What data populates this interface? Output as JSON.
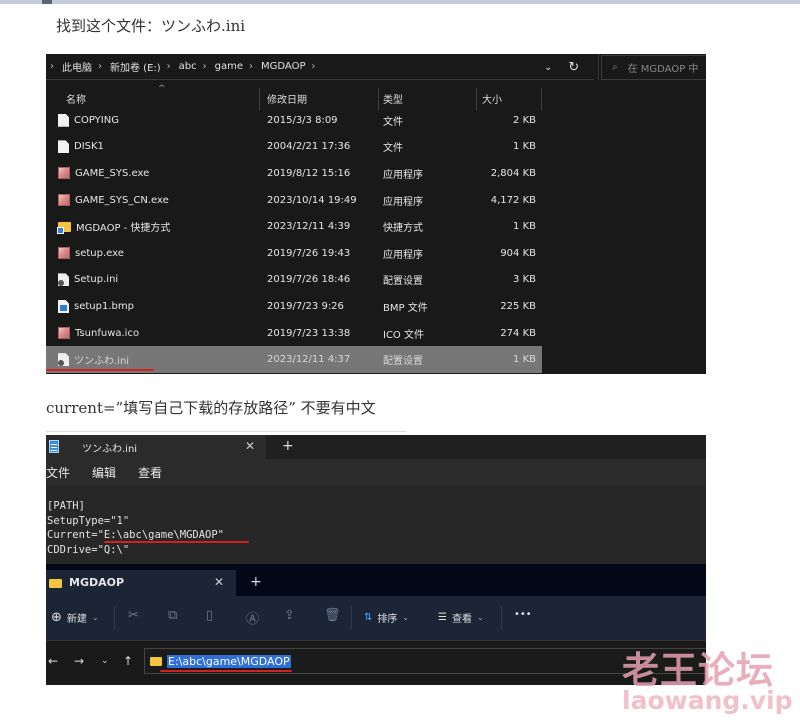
{
  "captions": {
    "step1": "找到这个文件：ツンふわ.ini",
    "step2": "current=”填写自己下载的存放路径”  不要有中文"
  },
  "explorer1": {
    "breadcrumb": [
      "此电脑",
      "新加卷 (E:)",
      "abc",
      "game",
      "MGDAOP"
    ],
    "search_placeholder": "在 MGDAOP 中",
    "columns": {
      "name": "名称",
      "date": "修改日期",
      "type": "类型",
      "size": "大小"
    },
    "files": [
      {
        "name": "COPYING",
        "date": "2015/3/3 8:09",
        "type": "文件",
        "size": "2 KB",
        "icon": "document-icon"
      },
      {
        "name": "DISK1",
        "date": "2004/2/21 17:36",
        "type": "文件",
        "size": "1 KB",
        "icon": "document-icon"
      },
      {
        "name": "GAME_SYS.exe",
        "date": "2019/8/12 15:16",
        "type": "应用程序",
        "size": "2,804 KB",
        "icon": "app-icon"
      },
      {
        "name": "GAME_SYS_CN.exe",
        "date": "2023/10/14 19:49",
        "type": "应用程序",
        "size": "4,172 KB",
        "icon": "app-icon"
      },
      {
        "name": "MGDAOP - 快捷方式",
        "date": "2023/12/11 4:39",
        "type": "快捷方式",
        "size": "1 KB",
        "icon": "shortcut-folder-icon"
      },
      {
        "name": "setup.exe",
        "date": "2019/7/26 19:43",
        "type": "应用程序",
        "size": "904 KB",
        "icon": "app-icon"
      },
      {
        "name": "Setup.ini",
        "date": "2019/7/26 18:46",
        "type": "配置设置",
        "size": "3 KB",
        "icon": "settings-file-icon"
      },
      {
        "name": "setup1.bmp",
        "date": "2019/7/23 9:26",
        "type": "BMP 文件",
        "size": "225 KB",
        "icon": "image-file-icon"
      },
      {
        "name": "Tsunfuwa.ico",
        "date": "2019/7/23 13:38",
        "type": "ICO 文件",
        "size": "274 KB",
        "icon": "app-icon"
      },
      {
        "name": "ツンふわ.ini",
        "date": "2023/12/11 4:37",
        "type": "配置设置",
        "size": "1 KB",
        "icon": "settings-file-icon",
        "selected": true
      }
    ]
  },
  "notepad": {
    "tab_title": "ツンふわ.ini",
    "menu": [
      "文件",
      "编辑",
      "查看"
    ],
    "lines": [
      "[PATH]",
      "SetupType=\"1\"",
      "Current=\"E:\\abc\\game\\MGDAOP\"",
      "CDDrive=\"Q:\\\""
    ]
  },
  "explorer2": {
    "tab_title": "MGDAOP",
    "toolbar": {
      "new_label": "新建",
      "sort_label": "排序",
      "view_label": "查看",
      "more_label": "•••"
    },
    "path": "E:\\abc\\game\\MGDAOP"
  },
  "watermark": {
    "title": "老王论坛",
    "url": "laowang.vip"
  }
}
